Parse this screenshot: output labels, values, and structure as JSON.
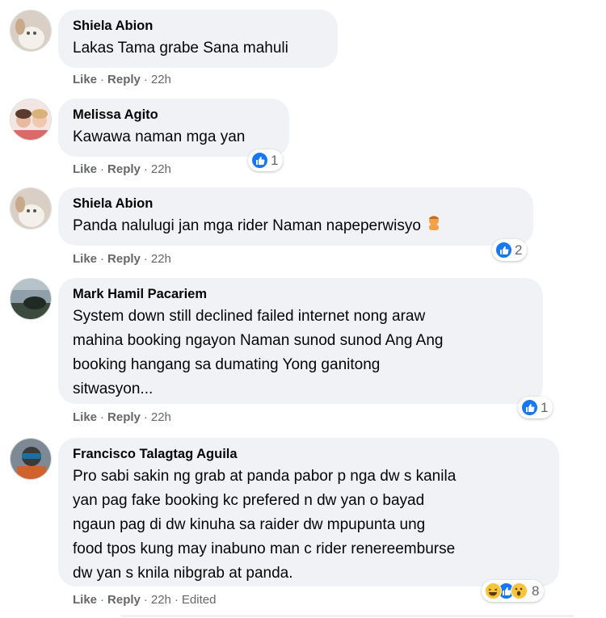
{
  "comments": [
    {
      "name": "Shiela Abion",
      "lines": [
        "Lakas Tama grabe Sana mahuli"
      ],
      "like": "Like",
      "reply": "Reply",
      "time": "22h"
    },
    {
      "name": "Melissa Agito",
      "lines": [
        "Kawawa naman mga yan"
      ],
      "like": "Like",
      "reply": "Reply",
      "time": "22h",
      "reaction_count": "1"
    },
    {
      "name": "Shiela Abion",
      "lines": [
        "Panda nalulugi jan mga rider Naman napeperwisyo"
      ],
      "like": "Like",
      "reply": "Reply",
      "time": "22h",
      "reaction_count": "2"
    },
    {
      "name": "Mark Hamil Pacariem",
      "lines": [
        "System down still declined failed internet nong araw",
        "mahina booking ngayon Naman sunod sunod Ang Ang",
        "booking hangang sa dumating Yong ganitong",
        "sitwasyon..."
      ],
      "like": "Like",
      "reply": "Reply",
      "time": "22h",
      "reaction_count": "1"
    },
    {
      "name": "Francisco Talagtag Aguila",
      "lines": [
        "Pro sabi sakin ng grab at panda pabor p nga dw s kanila",
        "yan pag fake booking kc prefered n dw yan o bayad",
        "ngaun pag di dw kinuha sa raider dw mpupunta ung",
        "food tpos kung may inabuno man c rider renereemburse",
        "dw yan s knila nibgrab at panda."
      ],
      "like": "Like",
      "reply": "Reply",
      "time": "22h",
      "edited": "Edited",
      "reaction_count": "8"
    }
  ],
  "colors": {
    "bubble": "#f0f2f5",
    "meta": "#65676b",
    "like_blue": "#1877f2"
  }
}
